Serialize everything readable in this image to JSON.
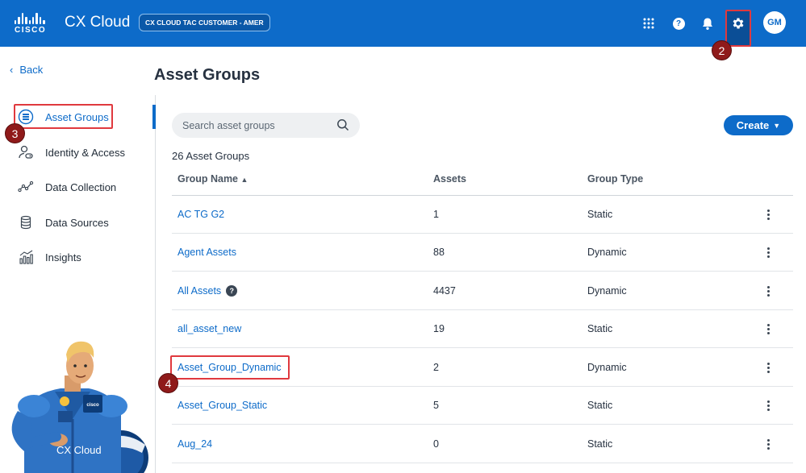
{
  "header": {
    "logo_word": "CISCO",
    "app_title": "CX Cloud",
    "tenant_badge": "CX CLOUD TAC CUSTOMER - AMER",
    "avatar_initials": "GM",
    "help_glyph": "?"
  },
  "callouts": {
    "gear": "2",
    "asset_groups": "3",
    "row": "4"
  },
  "sidebar": {
    "back_label": "Back",
    "items": [
      {
        "label": "Asset Groups",
        "icon": "asset-groups-icon"
      },
      {
        "label": "Identity & Access",
        "icon": "identity-icon"
      },
      {
        "label": "Data Collection",
        "icon": "data-collection-icon"
      },
      {
        "label": "Data Sources",
        "icon": "database-icon"
      },
      {
        "label": "Insights",
        "icon": "insights-icon"
      }
    ],
    "illustration_caption": "CX Cloud",
    "illustration_badge": "cisco"
  },
  "main": {
    "title": "Asset Groups",
    "search_placeholder": "Search asset groups",
    "create_label": "Create",
    "count_label": "26 Asset Groups",
    "columns": {
      "name": "Group Name",
      "assets": "Assets",
      "type": "Group Type"
    },
    "rows": [
      {
        "name": "AC TG G2",
        "assets": "1",
        "type": "Static"
      },
      {
        "name": "Agent Assets",
        "assets": "88",
        "type": "Dynamic"
      },
      {
        "name": "All Assets",
        "assets": "4437",
        "type": "Dynamic",
        "help": "?"
      },
      {
        "name": "all_asset_new",
        "assets": "19",
        "type": "Static"
      },
      {
        "name": "Asset_Group_Dynamic",
        "assets": "2",
        "type": "Dynamic"
      },
      {
        "name": "Asset_Group_Static",
        "assets": "5",
        "type": "Static"
      },
      {
        "name": "Aug_24",
        "assets": "0",
        "type": "Static"
      }
    ]
  },
  "colors": {
    "brand": "#0d6bc9",
    "callout": "#8f1a1a",
    "highlight": "#e0393e"
  }
}
